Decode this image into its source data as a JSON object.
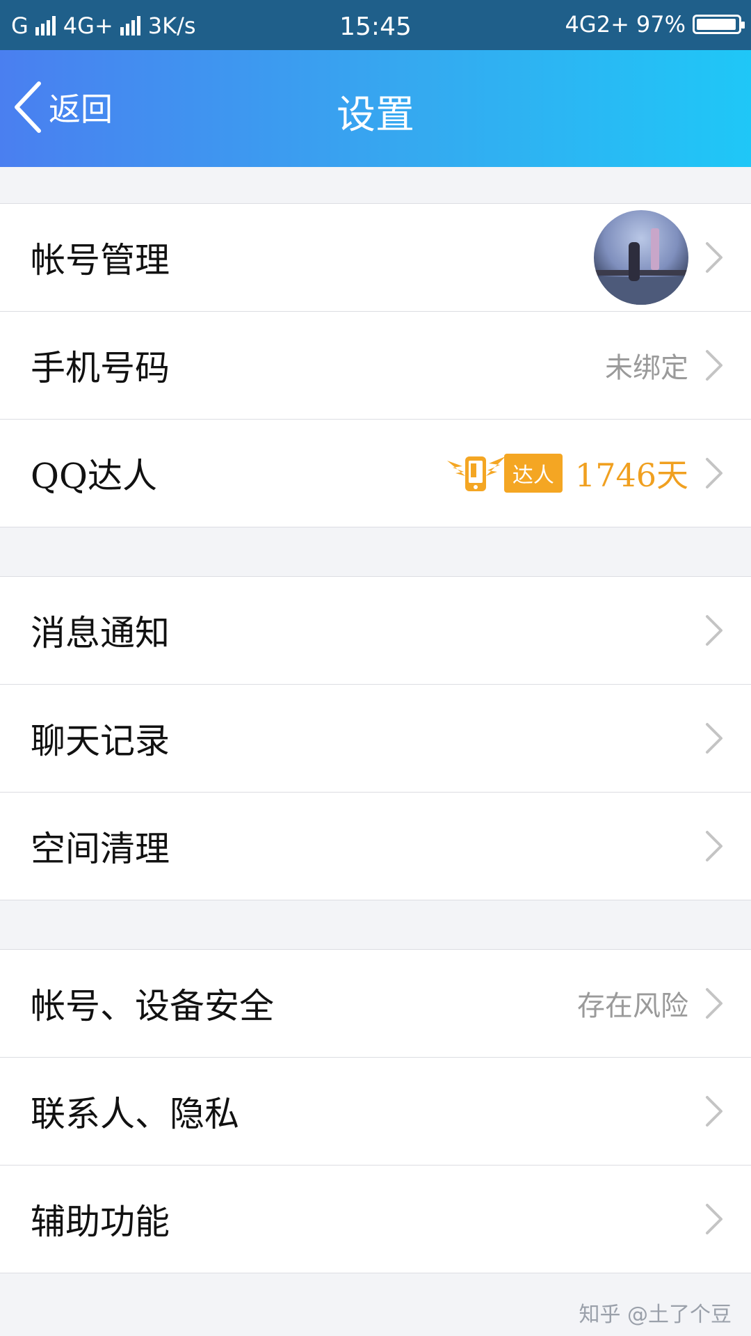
{
  "status_bar": {
    "carrier1": "G",
    "carrier2": "4G+",
    "speed": "3K/s",
    "time": "15:45",
    "network": "4G2+",
    "battery": "97%",
    "battery_level": 0.97
  },
  "nav": {
    "back_label": "返回",
    "title": "设置"
  },
  "groups": [
    {
      "items": [
        {
          "label": "帐号管理",
          "value": "",
          "right": "avatar"
        },
        {
          "label": "手机号码",
          "value": "未绑定"
        },
        {
          "label": "QQ达人",
          "badge_label": "达人",
          "badge_days": "1746天"
        }
      ]
    },
    {
      "items": [
        {
          "label": "消息通知",
          "value": ""
        },
        {
          "label": "聊天记录",
          "value": ""
        },
        {
          "label": "空间清理",
          "value": ""
        }
      ]
    },
    {
      "items": [
        {
          "label": "帐号、设备安全",
          "value": "存在风险"
        },
        {
          "label": "联系人、隐私",
          "value": ""
        },
        {
          "label": "辅助功能",
          "value": ""
        }
      ]
    }
  ],
  "watermark": "知乎 @土了个豆",
  "colors": {
    "nav_gradient_start": "#4a7ff0",
    "nav_gradient_end": "#1fc7f7",
    "badge": "#f4a623",
    "value_gray": "#9a9a9a"
  }
}
